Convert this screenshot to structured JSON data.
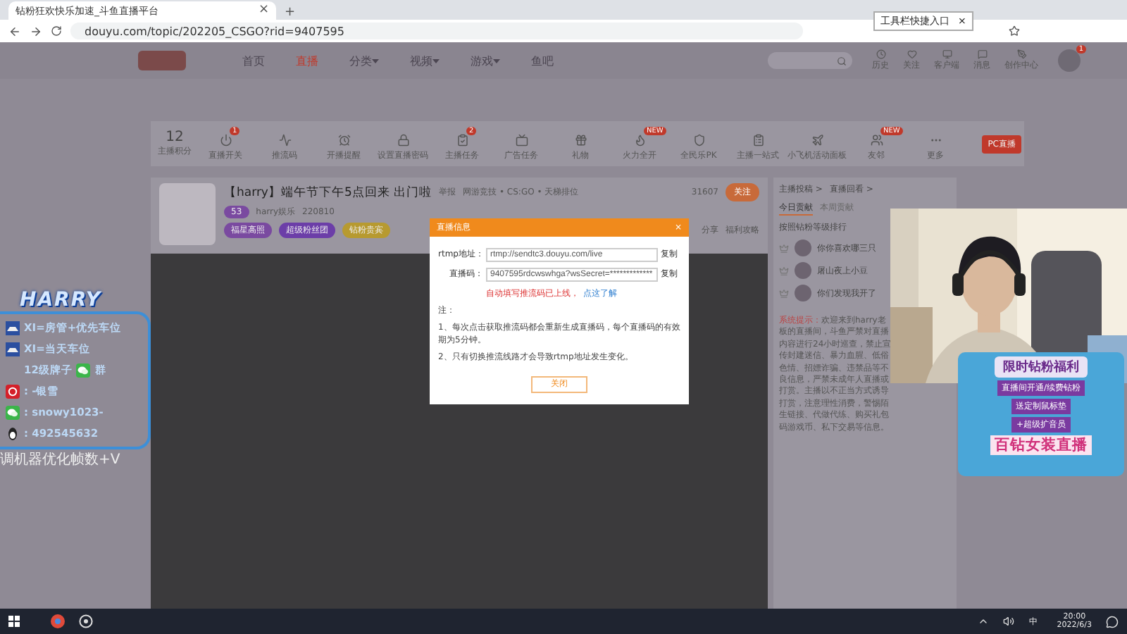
{
  "browser": {
    "tab_title": "钻粉狂欢快乐加速_斗鱼直播平台",
    "tab_close": "×",
    "new_tab": "+",
    "url": "douyu.com/topic/202205_CSGO?rid=9407595",
    "tooltip": "工具栏快捷入口",
    "tooltip_close": "×"
  },
  "site_nav": {
    "items": [
      {
        "label": "首页",
        "selected": false,
        "menu": false
      },
      {
        "label": "直播",
        "selected": true,
        "menu": false
      },
      {
        "label": "分类",
        "selected": false,
        "menu": true
      },
      {
        "label": "视频",
        "selected": false,
        "menu": true
      },
      {
        "label": "游戏",
        "selected": false,
        "menu": true
      },
      {
        "label": "鱼吧",
        "selected": false,
        "menu": false
      }
    ],
    "right_items": [
      {
        "label": "历史"
      },
      {
        "label": "关注"
      },
      {
        "label": "客户端"
      },
      {
        "label": "消息"
      },
      {
        "label": "创作中心"
      }
    ],
    "avatar_badge": "1"
  },
  "toolbar": {
    "score": "12",
    "score_label": "主播积分",
    "items": [
      {
        "label": "直播开关",
        "badge": "1"
      },
      {
        "label": "推流码"
      },
      {
        "label": "开播提醒"
      },
      {
        "label": "设置直播密码"
      },
      {
        "label": "主播任务",
        "badge": "2"
      },
      {
        "label": "广告任务"
      },
      {
        "label": "礼物"
      },
      {
        "label": "火力全开",
        "badge": "NEW"
      },
      {
        "label": "全民乐PK"
      },
      {
        "label": "主播一站式"
      },
      {
        "label": "小飞机活动面板"
      },
      {
        "label": "友邻",
        "badge": "NEW"
      },
      {
        "label": "更多"
      }
    ],
    "pc_button": "PC直播"
  },
  "stream": {
    "title": "【harry】端午节下午5点回来 出门啦",
    "report": "举报",
    "category": "网游竞技 • CS:GO • 天梯排位",
    "level": "53",
    "streamer": "harry娱乐",
    "heat": "220810",
    "followers": "31607",
    "follow": "关注",
    "tags": [
      "福星高照",
      "超级粉丝团",
      "钻粉贵宾"
    ],
    "share": "分享",
    "welfare": "福利攻略"
  },
  "dialog": {
    "title": "直播信息",
    "close": "×",
    "fields": [
      {
        "label": "rtmp地址：",
        "value": "rtmp://sendtc3.douyu.com/live",
        "copy": "复制"
      },
      {
        "label": "直播码：",
        "value": "9407595rdcwswhga?wsSecret=*************",
        "copy": "复制"
      }
    ],
    "notice": "自动填写推流码已上线，",
    "notice_link": "点这了解",
    "notes_title": "注：",
    "notes": [
      "1、每次点击获取推流码都会重新生成直播码，每个直播码的有效期为5分钟。",
      "2、只有切换推流线路才会导致rtmp地址发生变化。"
    ],
    "button": "关闭"
  },
  "side_panel": {
    "links": [
      "主播投稿 >",
      "直播回看 >"
    ],
    "tabs": [
      {
        "label": "今日贡献",
        "selected": true
      },
      {
        "label": "本周贡献",
        "selected": false
      }
    ],
    "rank_title": "按照钻粉等级排行",
    "ranks": [
      {
        "name": "你你喜欢哪三只"
      },
      {
        "name": "屠山夜上小豆"
      },
      {
        "name": "你们发现我开了"
      }
    ],
    "system_label": "系统提示：",
    "system_text": "欢迎来到harry老板的直播间，斗鱼严禁对直播内容进行24小时巡查，禁止宣传封建迷信、暴力血腥、低俗色情、招嫖诈骗、违禁品等不良信息，严禁未成年人直播或打赏。主播以不正当方式诱导打赏，注意理性消费，警惕陌生链接、代做代练、购买礼包码游戏币、私下交易等信息。"
  },
  "left_overlay": {
    "logo": "HARRY",
    "lines": [
      {
        "kind": "car",
        "text": "XI=房管+优先车位"
      },
      {
        "kind": "car",
        "text": "XI=当天车位"
      },
      {
        "kind": "group",
        "text": "12级牌子",
        "suffix": "群"
      },
      {
        "kind": "netease",
        "text": ": -银雪"
      },
      {
        "kind": "wechat",
        "text": ": snowy1023-"
      },
      {
        "kind": "qq",
        "text": ": 492545632"
      }
    ],
    "caption": "调机器优化帧数+V"
  },
  "promo": {
    "title": "限时钻粉福利",
    "line1": "直播间开通/续费钻粉",
    "line2": "送定制鼠标垫",
    "line3": "+超级扩音员",
    "footer": "百钻女装直播"
  },
  "taskbar": {
    "ime": "中",
    "time": "20:00",
    "date": "2022/6/3"
  }
}
